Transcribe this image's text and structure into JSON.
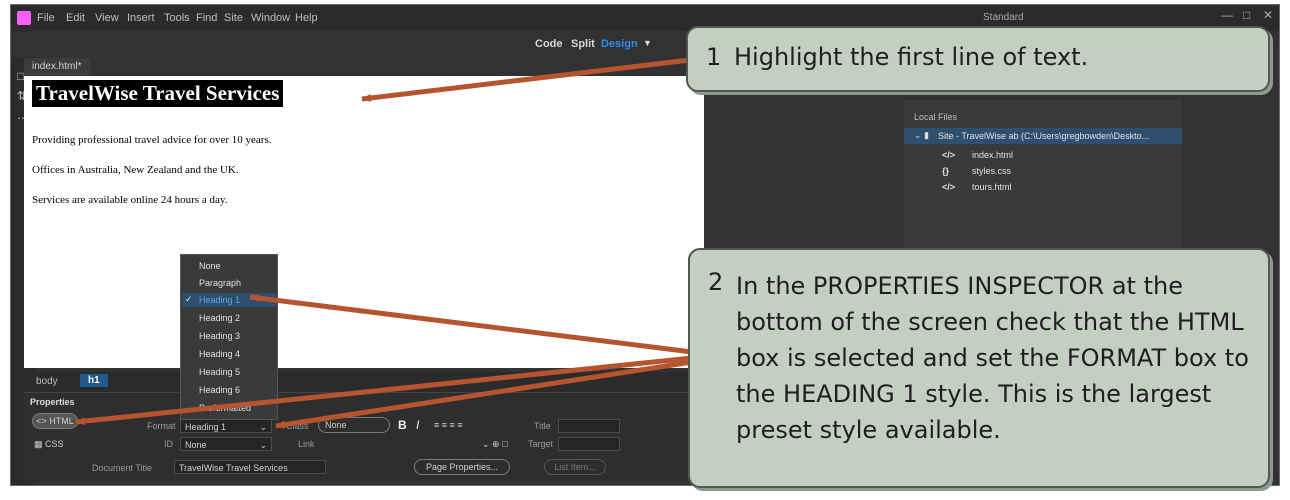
{
  "menu": [
    "File",
    "Edit",
    "View",
    "Insert",
    "Tools",
    "Find",
    "Site",
    "Window",
    "Help"
  ],
  "workspace": "Standard",
  "view_buttons": {
    "code": "Code",
    "split": "Split",
    "design": "Design"
  },
  "document_tab": "index.html*",
  "page": {
    "heading": "TravelWise Travel Services",
    "paragraphs": [
      "Providing professional travel advice for over 10 years.",
      "Offices in Australia, New Zealand and the UK.",
      "Services are available online 24 hours a day."
    ]
  },
  "format_menu": {
    "items": [
      "None",
      "Paragraph",
      "Heading 1",
      "Heading 2",
      "Heading 3",
      "Heading 4",
      "Heading 5",
      "Heading 6",
      "Preformatted"
    ],
    "selected": "Heading 1"
  },
  "breadcrumbs": {
    "body": "body",
    "h1": "h1"
  },
  "properties": {
    "title": "Properties",
    "html_label": "HTML",
    "css_label": "CSS",
    "format_label": "Format",
    "format_value": "Heading 1",
    "id_label": "ID",
    "id_value": "None",
    "class_label": "Class",
    "class_value": "None",
    "link_label": "Link",
    "title_label": "Title",
    "target_label": "Target",
    "doc_title_label": "Document Title",
    "doc_title_value": "TravelWise Travel Services",
    "page_properties": "Page Properties...",
    "list_item": "List Item..."
  },
  "files_panel": {
    "local_label": "Local Files",
    "site": "Site - TravelWise ab (C:\\Users\\gregbowden\\Deskto...",
    "files": [
      {
        "icon": "</>",
        "name": "index.html"
      },
      {
        "icon": "{}",
        "name": "styles.css"
      },
      {
        "icon": "</>",
        "name": "tours.html"
      }
    ]
  },
  "callouts": [
    {
      "number": "1",
      "text": "Highlight the first line of text."
    },
    {
      "number": "2",
      "text": "In the PROPERTIES INSPECTOR at the bottom of the screen check that the HTML box is selected and set the FORMAT box to the HEADING 1 style.  This is the largest preset style available."
    }
  ],
  "colors": {
    "callout_bg": "#c3cfc1",
    "arrow": "#b5542f",
    "selection": "#2f4f6f",
    "accent_blue": "#225a8a"
  }
}
